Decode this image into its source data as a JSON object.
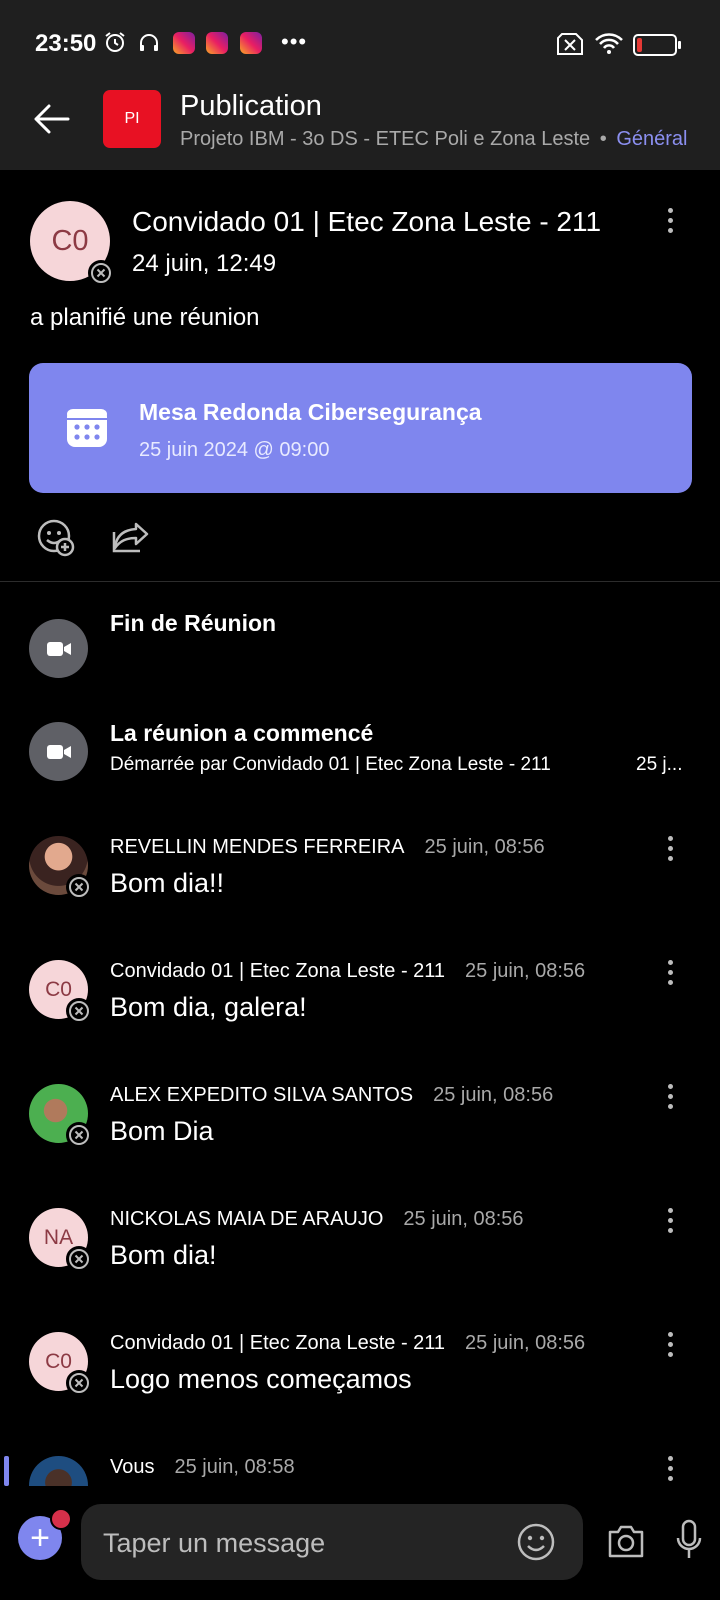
{
  "status_bar": {
    "time": "23:50",
    "icons": [
      "alarm-icon",
      "headphones-icon",
      "instagram-icon",
      "instagram-icon",
      "instagram-icon",
      "more-dots-icon",
      "no-sim-icon",
      "wifi-icon",
      "battery-low-icon"
    ]
  },
  "header": {
    "back_icon": "arrow-left-icon",
    "team_initials": "PI",
    "title": "Publication",
    "subtitle": "Projeto IBM - 3o DS - ETEC Poli e Zona Leste",
    "separator": "•",
    "channel": "Général"
  },
  "post": {
    "avatar_initials": "C0",
    "author": "Convidado 01 | Etec Zona Leste - 211",
    "date": "24 juin, 12:49",
    "text": "a planifié une réunion",
    "meeting_card": {
      "title": "Mesa Redonda Cibersegurança",
      "date": "25 juin 2024 @ 09:00"
    },
    "actions": [
      "add-reaction-icon",
      "share-icon"
    ]
  },
  "system_events": [
    {
      "title": "Fin de Réunion"
    },
    {
      "title": "La réunion a commencé",
      "subtitle": "Démarrée par Convidado 01 | Etec Zona Leste - 211",
      "time": "25 j..."
    }
  ],
  "messages": [
    {
      "author": "REVELLIN MENDES FERREIRA",
      "time": "25 juin, 08:56",
      "body": "Bom dia!!",
      "avatar": "photo"
    },
    {
      "author": "Convidado 01 | Etec Zona Leste - 211",
      "time": "25 juin, 08:56",
      "body": "Bom dia, galera!",
      "avatar": "C0"
    },
    {
      "author": "ALEX EXPEDITO SILVA SANTOS",
      "time": "25 juin, 08:56",
      "body": "Bom Dia",
      "avatar": "photo"
    },
    {
      "author": "NICKOLAS MAIA DE ARAUJO",
      "time": "25 juin, 08:56",
      "body": "Bom dia!",
      "avatar": "NA"
    },
    {
      "author": "Convidado 01 | Etec Zona Leste - 211",
      "time": "25 juin, 08:56",
      "body": "Logo menos começamos",
      "avatar": "C0"
    },
    {
      "author": "Vous",
      "time": "25 juin, 08:58",
      "body": "",
      "avatar": "photo"
    }
  ],
  "composer": {
    "placeholder": "Taper un message",
    "icons": [
      "plus-icon",
      "emoji-icon",
      "camera-icon",
      "microphone-icon"
    ]
  },
  "colors": {
    "accent": "#7f86ee",
    "header_bg": "#1f1f1f",
    "team_tile": "#e81123",
    "avatar_pink": "#f6d6d9",
    "avatar_text": "#8c3a44"
  }
}
